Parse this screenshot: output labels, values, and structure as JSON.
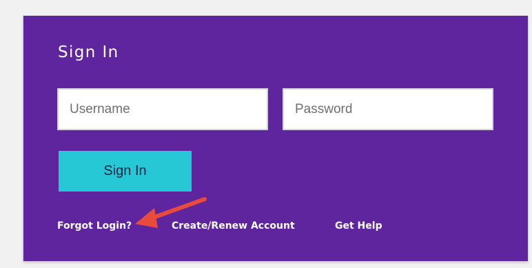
{
  "page": {
    "title": "Sign In"
  },
  "form": {
    "username_placeholder": "Username",
    "password_placeholder": "Password",
    "submit_label": "Sign In"
  },
  "links": {
    "forgot_login": "Forgot Login?",
    "create_renew": "Create/Renew Account",
    "get_help": "Get Help"
  },
  "colors": {
    "background": "#f1f1f1",
    "card": "#5f259f",
    "button": "#25c8d4",
    "button_text": "#1b2344",
    "text": "#ffffff",
    "annotation_arrow": "#e84b3c"
  },
  "annotation": {
    "icon": "red-arrow-icon"
  }
}
